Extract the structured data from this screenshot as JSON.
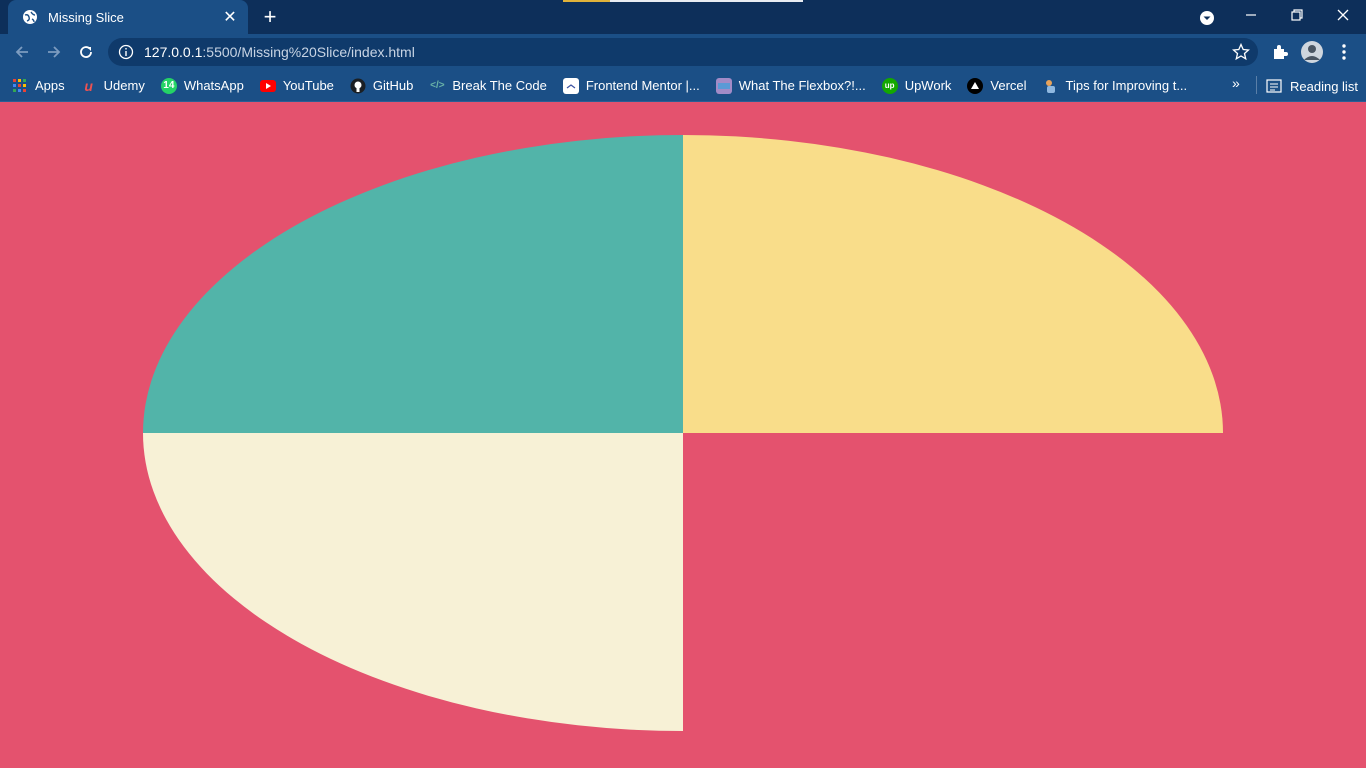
{
  "browser": {
    "tab_title": "Missing Slice",
    "url_host": "127.0.0.1",
    "url_path": ":5500/Missing%20Slice/index.html",
    "bookmarks": [
      {
        "label": "Apps",
        "icon": "apps-grid-icon"
      },
      {
        "label": "Udemy",
        "icon": "udemy-icon"
      },
      {
        "label": "WhatsApp",
        "icon": "whatsapp-icon"
      },
      {
        "label": "YouTube",
        "icon": "youtube-icon"
      },
      {
        "label": "GitHub",
        "icon": "github-icon"
      },
      {
        "label": "Break The Code",
        "icon": "code-icon"
      },
      {
        "label": "Frontend Mentor |...",
        "icon": "frontend-mentor-icon"
      },
      {
        "label": "What The Flexbox?!...",
        "icon": "flexbox-icon"
      },
      {
        "label": "UpWork",
        "icon": "upwork-icon"
      },
      {
        "label": "Vercel",
        "icon": "vercel-icon"
      },
      {
        "label": "Tips for Improving t...",
        "icon": "tips-icon"
      }
    ],
    "reading_list": "Reading list",
    "more_bookmarks": "»"
  },
  "page": {
    "background": "#e4526e",
    "slices": [
      {
        "name": "top-left-slice",
        "color": "#52b4a9"
      },
      {
        "name": "top-right-slice",
        "color": "#f9dd8a"
      },
      {
        "name": "bottom-left-slice",
        "color": "#f7f1d6"
      }
    ]
  }
}
